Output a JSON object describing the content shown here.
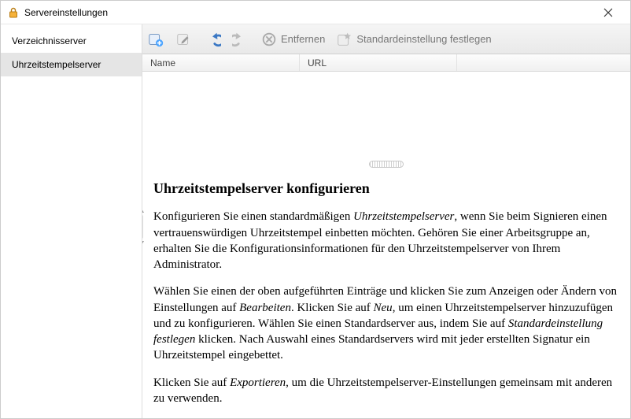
{
  "window": {
    "title": "Servereinstellungen"
  },
  "sidebar": {
    "items": [
      {
        "label": "Verzeichnisserver",
        "selected": false
      },
      {
        "label": "Uhrzeitstempelserver",
        "selected": true
      }
    ]
  },
  "toolbar": {
    "add": {
      "tooltip": "Neu"
    },
    "edit": {
      "tooltip": "Bearbeiten"
    },
    "undo": {
      "tooltip": "Rückgängig"
    },
    "redo": {
      "tooltip": "Wiederholen"
    },
    "remove": {
      "label": "Entfernen"
    },
    "set_default": {
      "label": "Standardeinstellung festlegen"
    }
  },
  "list": {
    "columns": {
      "name": "Name",
      "url": "URL"
    },
    "rows": []
  },
  "help": {
    "heading": "Uhrzeitstempelserver konfigurieren",
    "p1a": "Konfigurieren Sie einen standardmäßigen ",
    "p1i1": "Uhrzeitstempelserver",
    "p1b": ", wenn Sie beim Signieren einen vertrauenswürdigen Uhrzeitstempel einbetten möchten. Gehören Sie einer Arbeitsgruppe an, erhalten Sie die Konfigurationsinformationen für den Uhrzeitstempelserver von Ihrem Administrator.",
    "p2a": "Wählen Sie einen der oben aufgeführten Einträge und klicken Sie zum Anzeigen oder Ändern von Einstellungen auf ",
    "p2i1": "Bearbeiten",
    "p2b": ". Klicken Sie auf ",
    "p2i2": "Neu",
    "p2c": ", um einen Uhrzeitstempelserver hinzuzufügen und zu konfigurieren. Wählen Sie einen Standardserver aus, indem Sie auf ",
    "p2i3": "Standardeinstellung festlegen",
    "p2d": " klicken. Nach Auswahl eines Standardservers wird mit jeder erstellten Signatur ein Uhrzeitstempel eingebettet.",
    "p3a": "Klicken Sie auf ",
    "p3i1": "Exportieren",
    "p3b": ", um die Uhrzeitstempelserver-Einstellungen gemeinsam mit anderen zu verwenden."
  }
}
